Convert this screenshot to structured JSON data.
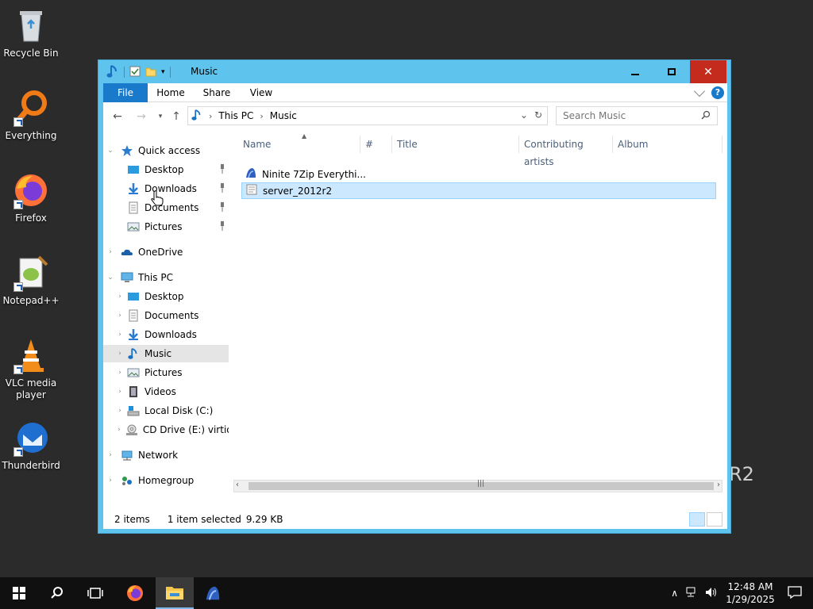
{
  "desktop": {
    "icons": [
      {
        "label": "Recycle Bin",
        "icon": "recycle-bin-icon"
      },
      {
        "label": "Everything",
        "icon": "everything-search-icon"
      },
      {
        "label": "Firefox",
        "icon": "firefox-icon"
      },
      {
        "label": "Notepad++",
        "icon": "notepad-plus-plus-icon"
      },
      {
        "label": "VLC media player",
        "icon": "vlc-icon"
      },
      {
        "label": "Thunderbird",
        "icon": "thunderbird-icon"
      }
    ],
    "watermark": "R2"
  },
  "window": {
    "title": "Music",
    "controls": {
      "minimize": "minimize",
      "maximize": "maximize",
      "close": "✕"
    },
    "ribbon": {
      "file": "File",
      "home": "Home",
      "share": "Share",
      "view": "View",
      "help": "?"
    },
    "address": {
      "root": "This PC",
      "current": "Music"
    },
    "search": {
      "placeholder": "Search Music"
    },
    "nav": {
      "quick_access": "Quick access",
      "qa_items": [
        "Desktop",
        "Downloads",
        "Documents",
        "Pictures"
      ],
      "onedrive": "OneDrive",
      "this_pc": "This PC",
      "pc_items": [
        "Desktop",
        "Documents",
        "Downloads",
        "Music",
        "Pictures",
        "Videos",
        "Local Disk (C:)",
        "CD Drive (E:) virtio-win"
      ],
      "network": "Network",
      "homegroup": "Homegroup"
    },
    "columns": [
      "Name",
      "#",
      "Title",
      "Contributing artists",
      "Album"
    ],
    "files": [
      {
        "name": "Ninite 7Zip Everythi...",
        "icon": "ninite-icon",
        "selected": false
      },
      {
        "name": "server_2012r2",
        "icon": "text-file-icon",
        "selected": true
      }
    ],
    "status": {
      "count": "2 items",
      "selection": "1 item selected",
      "size": "9.29 KB"
    }
  },
  "taskbar": {
    "time": "12:48 AM",
    "date": "1/29/2025"
  },
  "colors": {
    "accent": "#1979ca",
    "titlebar": "#5ec4ee",
    "close": "#c42b1c",
    "selection": "#cce8ff"
  }
}
